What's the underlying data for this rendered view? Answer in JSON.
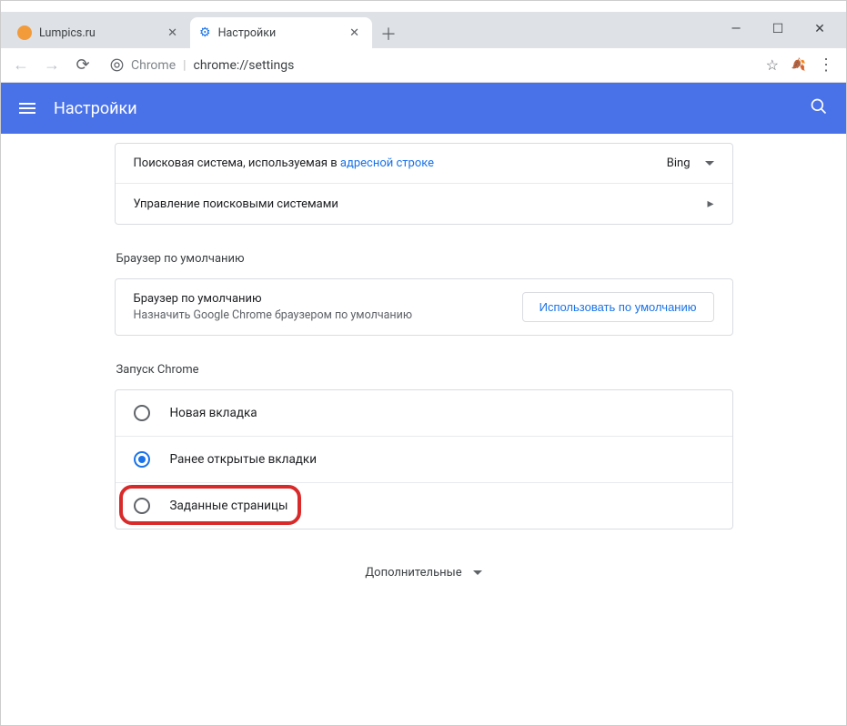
{
  "tabs": [
    {
      "title": "Lumpics.ru",
      "icon": "orange-circle"
    },
    {
      "title": "Настройки",
      "icon": "gear"
    }
  ],
  "toolbar": {
    "secure_label": "Chrome",
    "url_path": "chrome://settings"
  },
  "settings_header": {
    "title": "Настройки"
  },
  "search_engine": {
    "row1_prefix": "Поисковая система, используемая в ",
    "row1_link": "адресной строке",
    "selected": "Bing",
    "row2": "Управление поисковыми системами"
  },
  "default_browser": {
    "section_title": "Браузер по умолчанию",
    "title": "Браузер по умолчанию",
    "subtitle": "Назначить Google Chrome браузером по умолчанию",
    "button": "Использовать по умолчанию"
  },
  "on_startup": {
    "section_title": "Запуск Chrome",
    "options": [
      {
        "label": "Новая вкладка",
        "selected": false
      },
      {
        "label": "Ранее открытые вкладки",
        "selected": true
      },
      {
        "label": "Заданные страницы",
        "selected": false
      }
    ]
  },
  "advanced_label": "Дополнительные"
}
